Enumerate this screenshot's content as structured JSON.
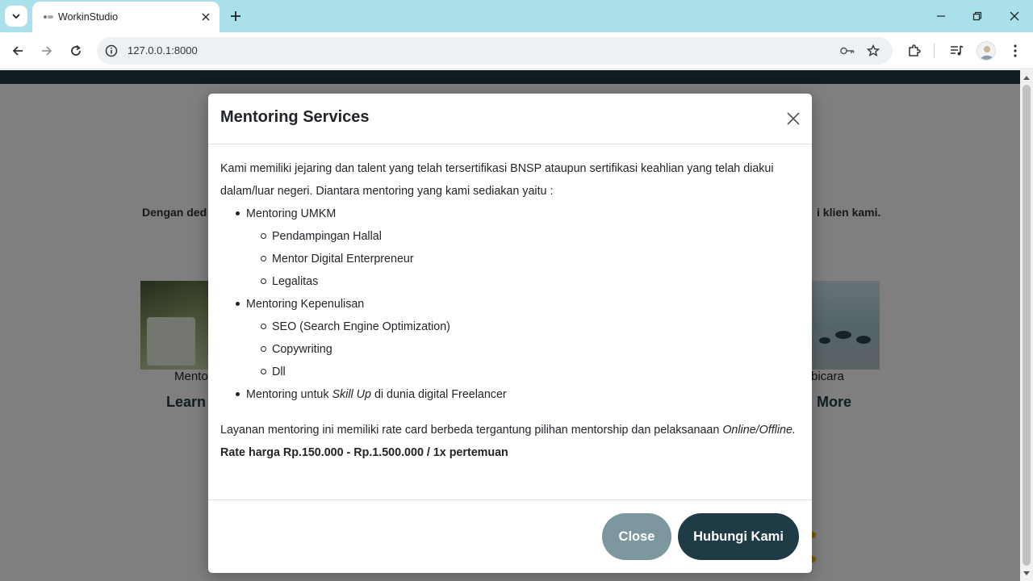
{
  "browser": {
    "tab_title": "WorkinStudio",
    "url": "127.0.0.1:8000"
  },
  "page": {
    "description_left": "Dengan ded",
    "description_right": "i klien kami.",
    "card_left_label": "Mento",
    "card_right_label": "bicara",
    "card_left_link": "Learn",
    "card_right_link": "More"
  },
  "modal": {
    "title": "Mentoring Services",
    "intro": "Kami memiliki jejaring dan talent yang telah tersertifikasi BNSP ataupun sertifikasi keahlian yang telah diakui dalam/luar negeri. Diantara mentoring yang kami sediakan yaitu :",
    "list": {
      "umkm": {
        "label": "Mentoring UMKM",
        "items": [
          "Pendampingan Hallal",
          "Mentor Digital Enterpreneur",
          "Legalitas"
        ]
      },
      "kepenulisan": {
        "label": "Mentoring Kepenulisan",
        "items": [
          "SEO (Search Engine Optimization)",
          "Copywriting",
          "Dll"
        ]
      },
      "skillup": {
        "prefix": "Mentoring untuk ",
        "emphasis": "Skill Up",
        "suffix": " di dunia digital Freelancer"
      }
    },
    "paragraph": "Layanan mentoring ini memiliki rate card berbeda tergantung pilihan mentorship dan pelaksanaan ",
    "paragraph_emphasis": "Online/Offline.",
    "rate": "Rate harga Rp.150.000 - Rp.1.500.000 / 1x pertemuan",
    "close_button": "Close",
    "contact_button": "Hubungi Kami"
  },
  "colors": {
    "tabbar": "#a9e0ea",
    "primary": "#1f3b45",
    "secondary": "#7c989e",
    "accent": "#f4b400"
  }
}
